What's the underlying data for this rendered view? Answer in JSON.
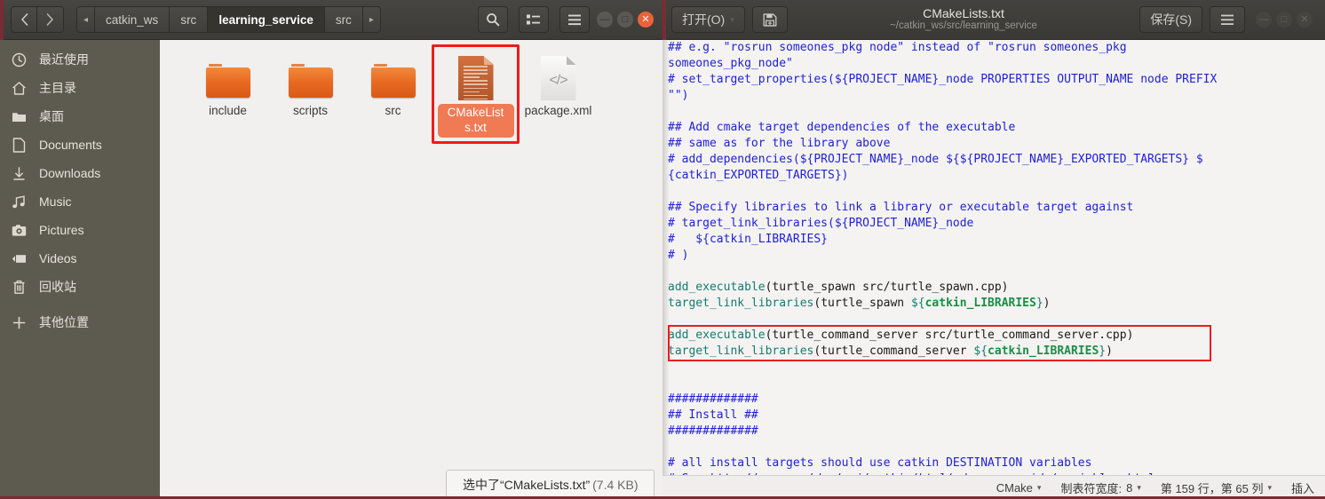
{
  "file_manager": {
    "window_title": "learning_service",
    "nav": {
      "back_icon": "chevron-left-icon",
      "forward_icon": "chevron-right-icon"
    },
    "breadcrumbs": [
      {
        "label": "◂",
        "kind": "arrow"
      },
      {
        "label": "catkin_ws",
        "kind": "crumb"
      },
      {
        "label": "src",
        "kind": "crumb"
      },
      {
        "label": "learning_service",
        "kind": "crumb-active"
      },
      {
        "label": "src",
        "kind": "crumb"
      },
      {
        "label": "▸",
        "kind": "arrow"
      }
    ],
    "toolbar": [
      {
        "name": "search-button",
        "icon": "search-icon",
        "glyph": "⌕"
      },
      {
        "name": "view-options-button",
        "icon": "list-view-icon",
        "glyph": ""
      },
      {
        "name": "menu-button",
        "icon": "hamburger-menu-icon",
        "glyph": "≡"
      }
    ],
    "window_controls": [
      {
        "name": "minimize-button",
        "glyph": "—",
        "style": "normal"
      },
      {
        "name": "maximize-button",
        "glyph": "□",
        "style": "normal"
      },
      {
        "name": "close-button",
        "glyph": "✕",
        "style": "close"
      }
    ],
    "sidebar": [
      {
        "label": "最近使用",
        "icon": "clock-icon",
        "glyph": "◷"
      },
      {
        "label": "主目录",
        "icon": "home-icon",
        "glyph": "⌂"
      },
      {
        "label": "桌面",
        "icon": "folder-icon",
        "glyph": "▰"
      },
      {
        "label": "Documents",
        "icon": "document-icon",
        "glyph": "⬚"
      },
      {
        "label": "Downloads",
        "icon": "download-icon",
        "glyph": "↓"
      },
      {
        "label": "Music",
        "icon": "music-note-icon",
        "glyph": "♫"
      },
      {
        "label": "Pictures",
        "icon": "camera-icon",
        "glyph": "◉"
      },
      {
        "label": "Videos",
        "icon": "video-icon",
        "glyph": "▶"
      },
      {
        "label": "回收站",
        "icon": "trash-icon",
        "glyph": "☒"
      },
      {
        "label": "其他位置",
        "icon": "plus-icon",
        "glyph": "＋"
      }
    ],
    "files": [
      {
        "label": "include",
        "type": "folder",
        "selected": false
      },
      {
        "label": "scripts",
        "type": "folder",
        "selected": false
      },
      {
        "label": "src",
        "type": "folder",
        "selected": false
      },
      {
        "label": "CMakeLists.txt",
        "type": "text-document",
        "selected": true
      },
      {
        "label": "package.xml",
        "type": "xml-document",
        "selected": false
      }
    ],
    "status": {
      "text": "选中了“CMakeLists.txt”",
      "size": "(7.4 KB)"
    }
  },
  "editor": {
    "open_button": "打开(O)",
    "open_caret": "▾",
    "save_as_icon": "save-as-icon",
    "title": "CMakeLists.txt",
    "subtitle": "~/catkin_ws/src/learning_service",
    "save_button": "保存(S)",
    "menu_icon": "hamburger-menu-icon",
    "window_controls": [
      {
        "name": "minimize-button",
        "glyph": "—"
      },
      {
        "name": "maximize-button",
        "glyph": "□"
      },
      {
        "name": "close-button",
        "glyph": "✕"
      }
    ],
    "status": {
      "language": "CMake",
      "tab_width_label": "制表符宽度:",
      "tab_width_value": "8",
      "position": "第 159 行，第 65 列",
      "insert_mode": "插入",
      "caret": "▾"
    },
    "highlight_color": "#ee1c19",
    "lines": [
      [
        {
          "t": "## e.g. \"rosrun someones_pkg node\" instead of \"rosrun someones_pkg",
          "c": "cm"
        }
      ],
      [
        {
          "t": "someones_pkg_node\"",
          "c": "cm"
        }
      ],
      [
        {
          "t": "# set_target_properties(${PROJECT_NAME}_node PROPERTIES OUTPUT_NAME node PREFIX",
          "c": "cm"
        }
      ],
      [
        {
          "t": "\"\")",
          "c": "cm"
        }
      ],
      [
        {
          "t": "",
          "c": ""
        }
      ],
      [
        {
          "t": "## Add cmake target dependencies of the executable",
          "c": "cm"
        }
      ],
      [
        {
          "t": "## same as for the library above",
          "c": "cm"
        }
      ],
      [
        {
          "t": "# add_dependencies(${PROJECT_NAME}_node ${${PROJECT_NAME}_EXPORTED_TARGETS} $",
          "c": "cm"
        }
      ],
      [
        {
          "t": "{catkin_EXPORTED_TARGETS})",
          "c": "cm"
        }
      ],
      [
        {
          "t": "",
          "c": ""
        }
      ],
      [
        {
          "t": "## Specify libraries to link a library or executable target against",
          "c": "cm"
        }
      ],
      [
        {
          "t": "# target_link_libraries(${PROJECT_NAME}_node",
          "c": "cm"
        }
      ],
      [
        {
          "t": "#   ${catkin_LIBRARIES}",
          "c": "cm"
        }
      ],
      [
        {
          "t": "# )",
          "c": "cm"
        }
      ],
      [
        {
          "t": "",
          "c": ""
        }
      ],
      [
        {
          "t": "add_executable",
          "c": "fn"
        },
        {
          "t": "(turtle_spawn src/turtle_spawn.cpp)",
          "c": ""
        }
      ],
      [
        {
          "t": "target_link_libraries",
          "c": "fn"
        },
        {
          "t": "(turtle_spawn ",
          "c": ""
        },
        {
          "t": "${",
          "c": "dol"
        },
        {
          "t": "catkin_LIBRARIES",
          "c": "var"
        },
        {
          "t": "}",
          "c": "dol"
        },
        {
          "t": ")",
          "c": ""
        }
      ],
      [
        {
          "t": "",
          "c": ""
        }
      ],
      [
        {
          "t": "add_executable",
          "c": "fn"
        },
        {
          "t": "(turtle_command_server src/turtle_command_server.cpp)",
          "c": ""
        }
      ],
      [
        {
          "t": "target_link_libraries",
          "c": "fn"
        },
        {
          "t": "(turtle_command_server ",
          "c": ""
        },
        {
          "t": "${",
          "c": "dol"
        },
        {
          "t": "catkin_LIBRARIES",
          "c": "var"
        },
        {
          "t": "}",
          "c": "dol"
        },
        {
          "t": ")",
          "c": ""
        }
      ],
      [
        {
          "t": "",
          "c": ""
        }
      ],
      [
        {
          "t": "",
          "c": ""
        }
      ],
      [
        {
          "t": "#############",
          "c": "cm"
        }
      ],
      [
        {
          "t": "## Install ##",
          "c": "cm"
        }
      ],
      [
        {
          "t": "#############",
          "c": "cm"
        }
      ],
      [
        {
          "t": "",
          "c": ""
        }
      ],
      [
        {
          "t": "# all install targets should use catkin DESTINATION variables",
          "c": "cm"
        }
      ],
      [
        {
          "t": "# See ",
          "c": "cm"
        },
        {
          "t": "http://ros.org/doc/api/catkin/html/adv_user_guide/variables.html",
          "c": "lnk"
        }
      ]
    ]
  }
}
